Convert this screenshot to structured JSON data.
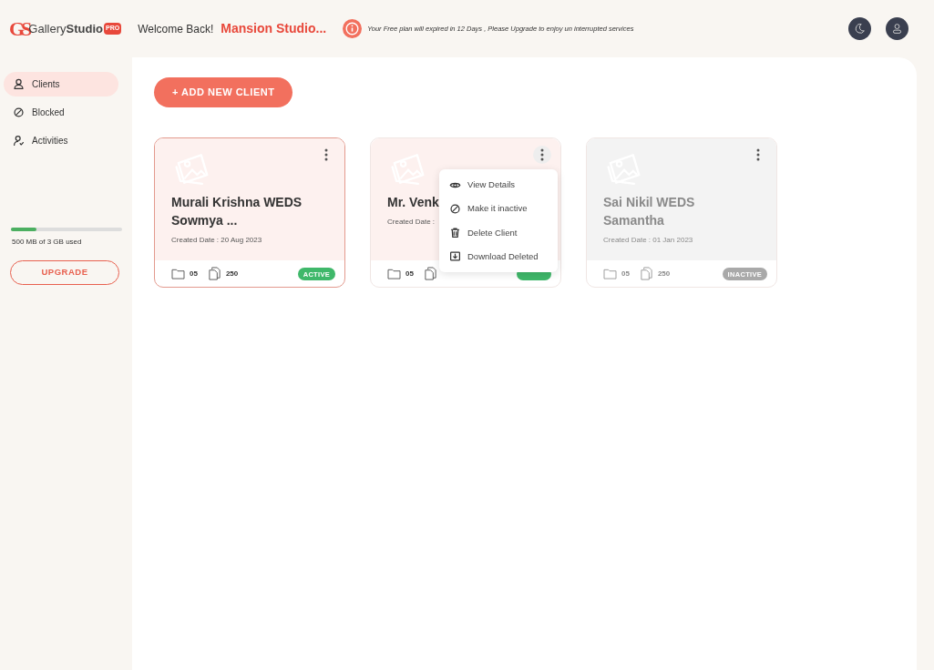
{
  "header": {
    "logo": {
      "mark": "GS",
      "name_light": "Gallery",
      "name_bold": "Studio",
      "badge": "PRO"
    },
    "welcome": "Welcome Back!",
    "studio": "Mansion Studio...",
    "notice": "Your Free plan will expired in 12 Days , Please Upgrade to enjoy un interrupted services"
  },
  "sidebar": {
    "items": [
      {
        "label": "Clients",
        "kind": "person",
        "selected": true
      },
      {
        "label": "Blocked",
        "kind": "blocked",
        "selected": false
      },
      {
        "label": "Activities",
        "kind": "activity",
        "selected": false
      }
    ],
    "storage": {
      "level": 0.23,
      "text": "500 MB of 3 GB used"
    },
    "upgrade": "UPGRADE"
  },
  "add_button": "+ ADD NEW CLIENT",
  "cards": [
    {
      "title": "Murali Krishna WEDS Sowmya ...",
      "date": "Created Date : 20 Aug 2023",
      "folders": "05",
      "files": "250",
      "active": true,
      "status_label": "ACTIVE",
      "selected": true
    },
    {
      "title": "Mr. Venk",
      "date": "Created Date :",
      "folders": "05",
      "active": true,
      "selected": false,
      "menu_open": true
    },
    {
      "title": "Sai Nikil WEDS Samantha",
      "date": "Created Date : 01 Jan 2023",
      "folders": "05",
      "files": "250",
      "active": false,
      "status_label": "INACTIVE",
      "selected": false
    }
  ],
  "menu": [
    {
      "label": "View Details",
      "kind": "view"
    },
    {
      "label": "Make it inactive",
      "kind": "blocked"
    },
    {
      "label": "Delete Client",
      "kind": "delete"
    },
    {
      "label": "Download Deleted",
      "kind": "download"
    }
  ]
}
